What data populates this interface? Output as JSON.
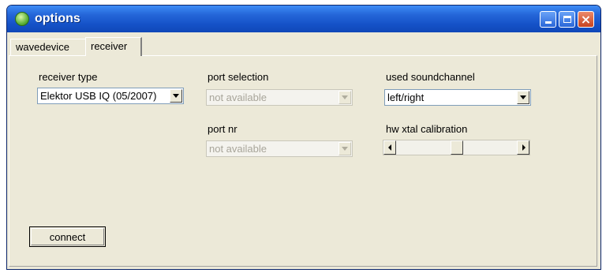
{
  "window": {
    "title": "options"
  },
  "tabs": [
    {
      "label": "wavedevice",
      "active": false
    },
    {
      "label": "receiver",
      "active": true
    }
  ],
  "receiver_type": {
    "label": "receiver type",
    "value": "Elektor USB IQ (05/2007)"
  },
  "port_selection": {
    "label": "port selection",
    "value": "not available",
    "enabled": false
  },
  "port_nr": {
    "label": "port nr",
    "value": "not available",
    "enabled": false
  },
  "soundchannel": {
    "label": "used soundchannel",
    "value": "left/right"
  },
  "xtal_calibration": {
    "label": "hw xtal calibration",
    "position": 0.5
  },
  "connect_button": {
    "label": "connect"
  },
  "icons": {
    "app": "app-icon",
    "minimize": "minimize-icon",
    "maximize": "maximize-icon",
    "close": "close-icon"
  },
  "colors": {
    "titlebar": "#2465d8",
    "face": "#ece9d8",
    "close": "#c8431f"
  }
}
